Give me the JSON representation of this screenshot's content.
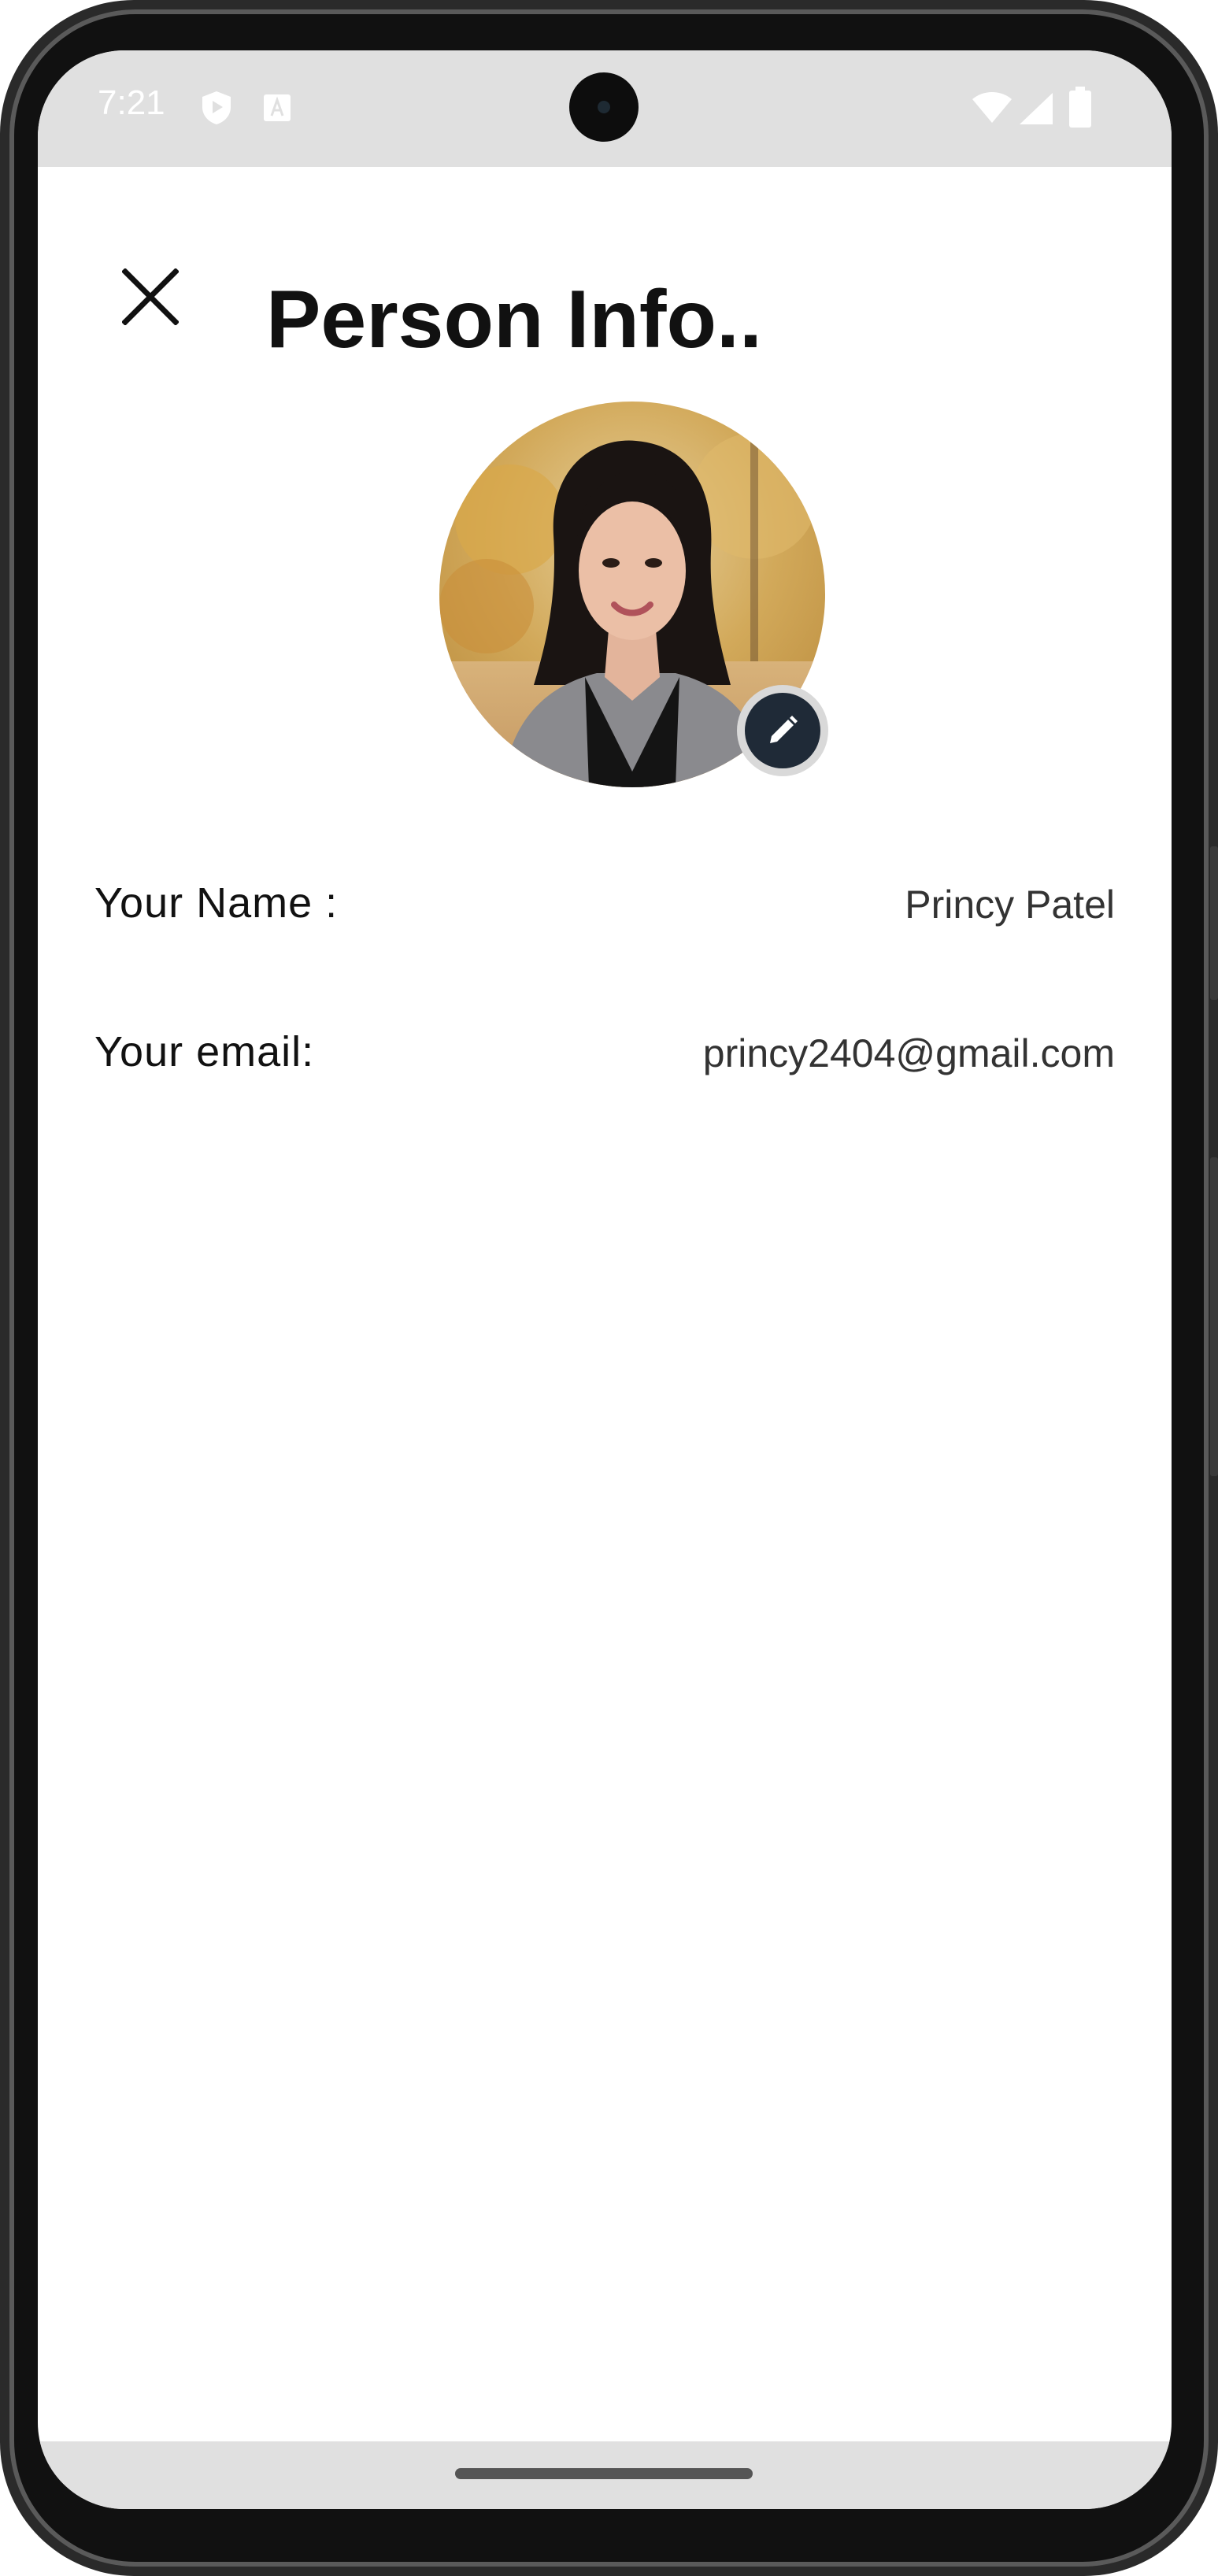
{
  "status_bar": {
    "time": "7:21",
    "icons": [
      "shield-play-icon",
      "font-a-icon",
      "wifi-icon",
      "signal-icon",
      "battery-icon"
    ]
  },
  "header": {
    "title": "Person Info..",
    "close_icon": "close-icon"
  },
  "profile": {
    "edit_icon": "pencil-icon"
  },
  "fields": {
    "name_label": "Your Name :",
    "name_value": "Princy Patel",
    "email_label": "Your email:",
    "email_value": "princy2404@gmail.com"
  },
  "colors": {
    "edit_button": "#1f2a37",
    "system_bars": "#e0e0e0"
  }
}
